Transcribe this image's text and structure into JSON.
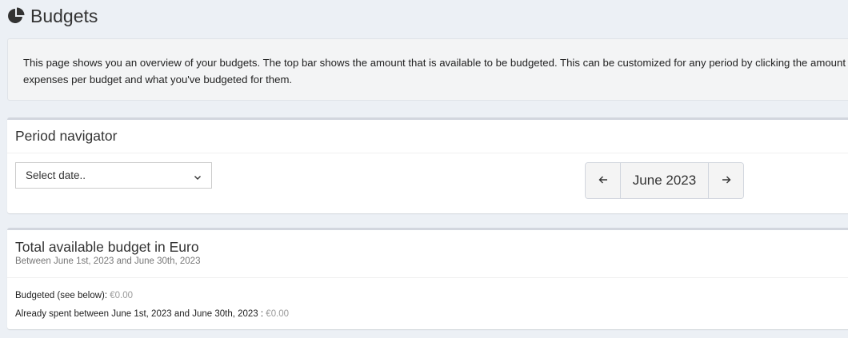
{
  "header": {
    "title": "Budgets",
    "icon": "pie-chart-icon"
  },
  "callout": {
    "line1": "This page shows you an overview of your budgets. The top bar shows the amount that is available to be budgeted. This can be customized for any period by clicking the amount o",
    "line2": "expenses per budget and what you've budgeted for them."
  },
  "period_navigator": {
    "title": "Period navigator",
    "select_value": "Select date..",
    "prev_icon": "arrow-left-icon",
    "current_period": "June 2023",
    "next_icon": "arrow-right-icon"
  },
  "available_budget": {
    "title": "Total available budget in Euro",
    "subtitle": "Between June 1st, 2023 and June 30th, 2023",
    "budgeted_label": "Budgeted (see below):",
    "budgeted_value": "€0.00",
    "spent_label": "Already spent between June 1st, 2023 and June 30th, 2023 :",
    "spent_value": "€0.00"
  },
  "colors": {
    "background": "#ecf0f5",
    "box_border": "#d2d6de",
    "muted_text": "#999999"
  }
}
